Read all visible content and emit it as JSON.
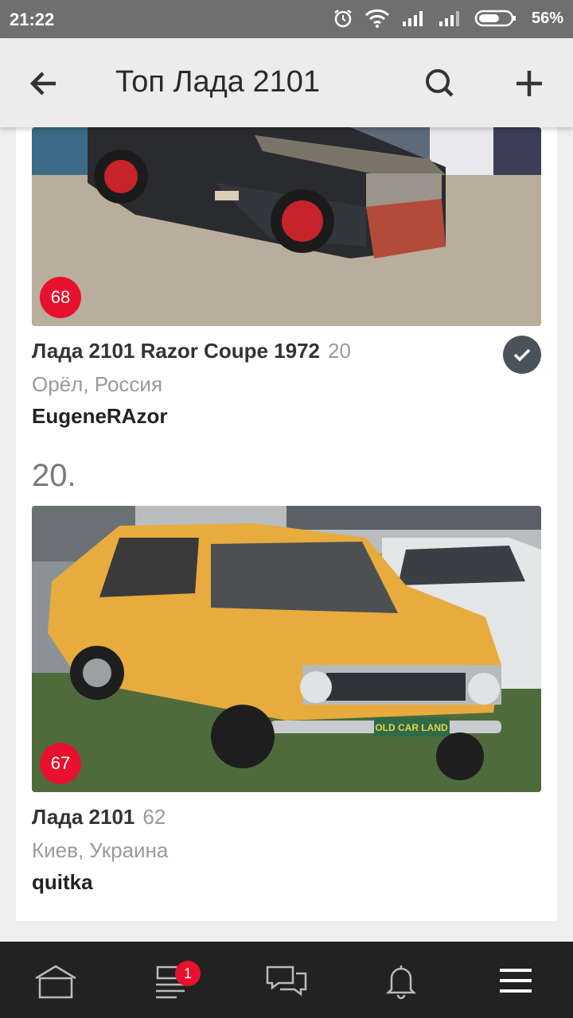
{
  "status": {
    "time": "21:22",
    "battery": "56%"
  },
  "header": {
    "title": "Топ Лада 2101"
  },
  "cars": [
    {
      "rank_badge": "68",
      "title": "Лада 2101 Razor Coupe 1972",
      "count": "20",
      "location": "Орёл, Россия",
      "author": "EugeneRAzor"
    },
    {
      "rank_heading": "20.",
      "rank_badge": "67",
      "title": "Лада 2101",
      "count": "62",
      "location": "Киев, Украина",
      "author": "quitka",
      "plate": "OLD CAR LAND"
    }
  ],
  "nav": {
    "feed_badge": "1"
  }
}
